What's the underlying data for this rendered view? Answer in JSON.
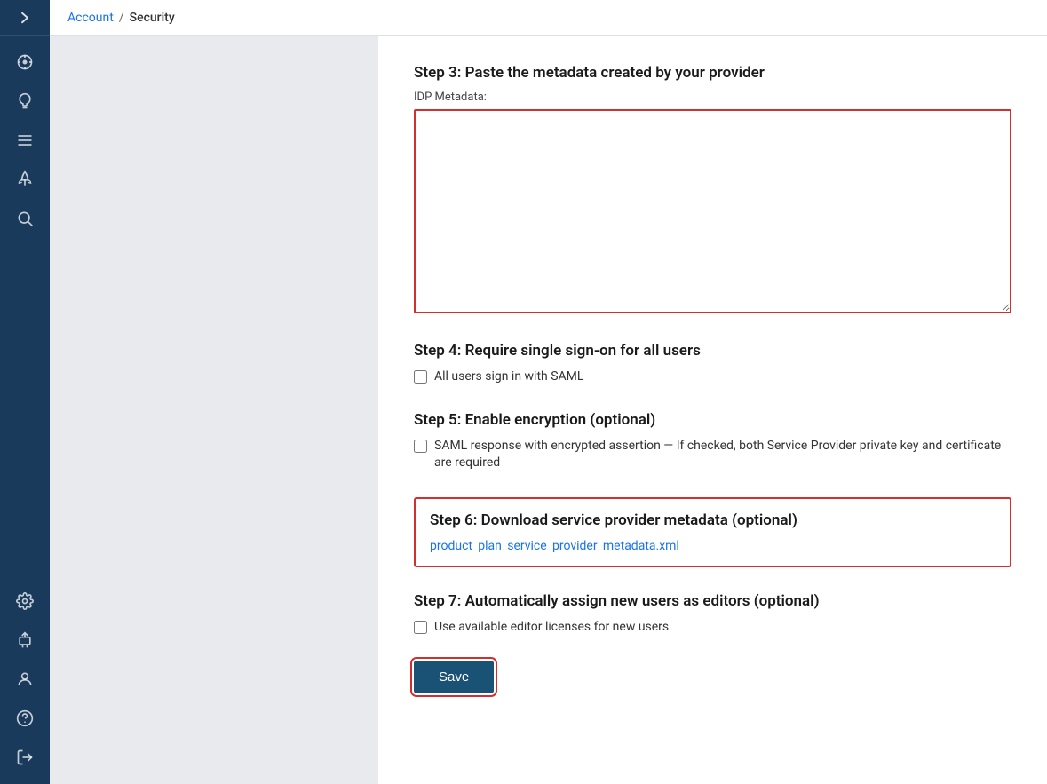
{
  "breadcrumb": {
    "account_label": "Account",
    "separator": "/",
    "current_label": "Security"
  },
  "sidebar": {
    "toggle_icon": "chevron-right",
    "icons": [
      {
        "name": "dashboard-icon",
        "symbol": "⊙"
      },
      {
        "name": "lightbulb-icon",
        "symbol": "💡"
      },
      {
        "name": "menu-icon",
        "symbol": "☰"
      },
      {
        "name": "rocket-icon",
        "symbol": "🚀"
      },
      {
        "name": "search-icon",
        "symbol": "🔍"
      }
    ],
    "bottom_icons": [
      {
        "name": "settings-icon",
        "symbol": "⚙"
      },
      {
        "name": "plugin-icon",
        "symbol": "🔌"
      },
      {
        "name": "user-icon",
        "symbol": "👤"
      },
      {
        "name": "help-icon",
        "symbol": "❓"
      },
      {
        "name": "logout-icon",
        "symbol": "↪"
      }
    ]
  },
  "steps": {
    "step3": {
      "title": "Step 3: Paste the metadata created by your provider",
      "idp_label": "IDP Metadata:",
      "idp_value": "",
      "idp_placeholder": ""
    },
    "step4": {
      "title": "Step 4: Require single sign-on for all users",
      "checkbox_label": "All users sign in with SAML",
      "checked": false
    },
    "step5": {
      "title": "Step 5: Enable encryption (optional)",
      "checkbox_label": "SAML response with encrypted assertion — If checked, both Service Provider private key and certificate are required",
      "checked": false
    },
    "step6": {
      "title": "Step 6: Download service provider metadata (optional)",
      "link_text": "product_plan_service_provider_metadata.xml",
      "link_href": "#"
    },
    "step7": {
      "title": "Step 7: Automatically assign new users as editors (optional)",
      "checkbox_label": "Use available editor licenses for new users",
      "checked": false
    }
  },
  "save_button": {
    "label": "Save"
  }
}
